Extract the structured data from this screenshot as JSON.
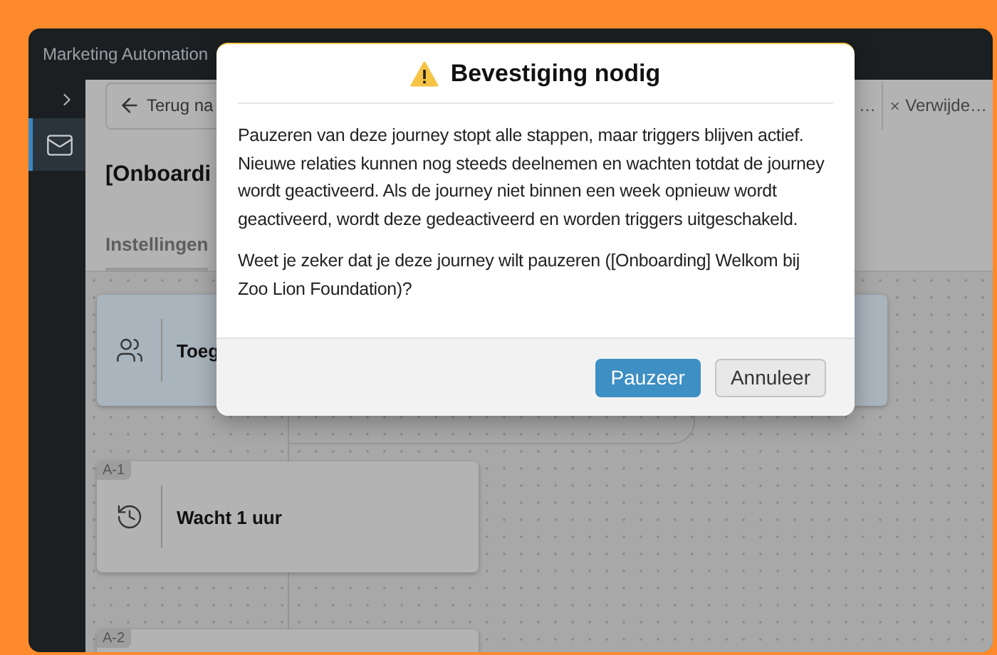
{
  "app": {
    "title": "Marketing Automation"
  },
  "sidebar": {
    "items": [
      {
        "selected": true
      }
    ]
  },
  "toolbar": {
    "back_button": "Terug na",
    "more_button": "…",
    "delete_button": "Verwijde…"
  },
  "page_title": "[Onboardi",
  "tabs": [
    {
      "label": "Instellingen",
      "selected": true
    }
  ],
  "canvas": {
    "nodes": [
      {
        "kind": "trigger",
        "title": "Toeg"
      },
      {
        "kind": "trigger"
      },
      {
        "kind": "step",
        "badge": "A-1",
        "title": "Wacht 1 uur"
      },
      {
        "kind": "step",
        "badge": "A-2"
      }
    ]
  },
  "dialog": {
    "title": "Bevestiging nodig",
    "paragraphs": [
      "Pauzeren van deze journey stopt alle stappen, maar triggers blijven actief. Nieuwe relaties kunnen nog steeds deelnemen en wachten totdat de journey wordt geactiveerd. Als de journey niet binnen een week opnieuw wordt geactiveerd, wordt deze gedeactiveerd en worden triggers uitgeschakeld.",
      "Weet je zeker dat je deze journey wilt pauzeren ([Onboarding] Welkom bij Zoo Lion Foundation)?"
    ],
    "buttons": [
      {
        "label": "Pauzeer",
        "kind": "primary"
      },
      {
        "label": "Annuleer",
        "kind": "secondary"
      }
    ]
  }
}
